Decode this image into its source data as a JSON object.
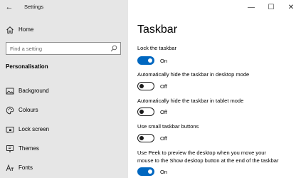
{
  "window": {
    "title": "Settings",
    "controls": {
      "minimize": "—",
      "maximize": "☐",
      "close": "✕"
    }
  },
  "sidebar": {
    "home_label": "Home",
    "search_placeholder": "Find a setting",
    "section_title": "Personalisation",
    "items": [
      {
        "label": "Background",
        "icon": "image-icon"
      },
      {
        "label": "Colours",
        "icon": "palette-icon"
      },
      {
        "label": "Lock screen",
        "icon": "lock-screen-icon"
      },
      {
        "label": "Themes",
        "icon": "themes-brush-icon"
      },
      {
        "label": "Fonts",
        "icon": "fonts-icon"
      }
    ]
  },
  "main": {
    "title": "Taskbar",
    "settings": [
      {
        "label": "Lock the taskbar",
        "state": "On",
        "on": true
      },
      {
        "label": "Automatically hide the taskbar in desktop mode",
        "state": "Off",
        "on": false
      },
      {
        "label": "Automatically hide the taskbar in tablet mode",
        "state": "Off",
        "on": false
      },
      {
        "label": "Use small taskbar buttons",
        "state": "Off",
        "on": false
      },
      {
        "label_line1": "Use Peek to preview the desktop when you move your",
        "label_line2": "mouse to the Show desktop button at the end of the taskbar",
        "state": "On",
        "on": true
      }
    ]
  },
  "colors": {
    "accent": "#0067c0",
    "sidebar_bg": "#e6e6e6"
  }
}
